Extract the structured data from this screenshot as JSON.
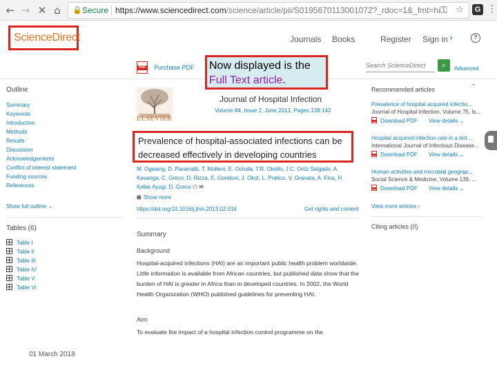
{
  "browser": {
    "secure_label": "Secure",
    "url_host": "https://www.sciencedirect.com",
    "url_path": "/science/article/pii/S0195670113001072?_rdoc=1&_fmt=hi..."
  },
  "header": {
    "logo": "ScienceDirect",
    "nav": [
      "Journals",
      "Books",
      "Register",
      "Sign in"
    ]
  },
  "toolbar": {
    "purchase_pdf": "Purchase PDF",
    "search_placeholder": "Search ScienceDirect",
    "advanced": "Advanced"
  },
  "callout": {
    "line1": "Now displayed is the",
    "highlight": "Full Text article",
    "period": "."
  },
  "outline": {
    "title": "Outline",
    "items": [
      "Summary",
      "Keywords",
      "Introduction",
      "Methods",
      "Results",
      "Discussion",
      "Acknowledgements",
      "Conflict of interest statement",
      "Funding sources",
      "References"
    ],
    "show_full": "Show full outline"
  },
  "tables": {
    "title": "Tables (6)",
    "items": [
      "Table I",
      "Table II",
      "Table III",
      "Table IV",
      "Table V",
      "Table VI"
    ]
  },
  "footer_date": "01 March 2018",
  "article": {
    "publisher": "ELSEVIER",
    "journal": "Journal of Hospital Infection",
    "journal_info": "Volume 84, Issue 2, June 2013, Pages 138-142",
    "title": "Prevalence of hospital-associated infections can be decreased effectively in developing countries",
    "authors": "M. Ogwang, D. Paramatti, T. Molteni, E. Ochola, T.R. Okello, J.C. Ortiz Salgado, A. Kavanga, C. Greco, D. Rizza, E. Gondoni, J. Okot, L. Pratico, V. Granata, A. Fina, H. Kellar Ayugi, D. Greco",
    "show_more": "Show more",
    "doi": "https://doi.org/10.1016/j.jhin.2013.02.016",
    "rights": "Get rights and content",
    "summary_heading": "Summary",
    "background_heading": "Background",
    "background_text": "Hospital-acquired infections (HAI) are an important public health problem worldwide. Little information is available from African countries, but published data show that the burden of HAI is greater in Africa than in developed countries. In 2002, the World Health Organization (WHO) published guidelines for preventing HAI.",
    "aim_heading": "Aim",
    "aim_text": "To evaluate the impact of a hospital infection control programme on the"
  },
  "sidebar": {
    "recommended_title": "Recommended articles",
    "items": [
      {
        "title": "Prevalence of hospital acquired infectio...",
        "source": "Journal of Hospital Infection, Volume 75, Is...",
        "download": "Download PDF",
        "details": "View details"
      },
      {
        "title": "Hospital acquired infection rate in a tert...",
        "source": "International Journal of Infectious Disease...",
        "download": "Download PDF",
        "details": "View details"
      },
      {
        "title": "Human activities and microbial geograp...",
        "source": "Social Science & Medicine, Volume 139, ...",
        "download": "Download PDF",
        "details": "View details"
      }
    ],
    "view_more": "View more articles",
    "citing": "Citing articles (0)"
  }
}
